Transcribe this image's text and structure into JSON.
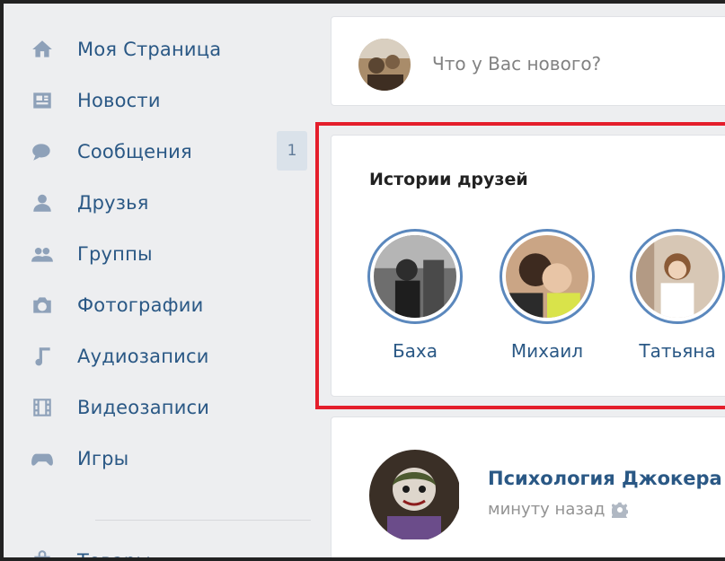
{
  "sidebar": {
    "items": [
      {
        "label": "Моя Страница",
        "icon": "home-icon"
      },
      {
        "label": "Новости",
        "icon": "news-icon"
      },
      {
        "label": "Сообщения",
        "icon": "messages-icon",
        "badge": "1"
      },
      {
        "label": "Друзья",
        "icon": "friends-icon"
      },
      {
        "label": "Группы",
        "icon": "groups-icon"
      },
      {
        "label": "Фотографии",
        "icon": "camera-icon"
      },
      {
        "label": "Аудиозаписи",
        "icon": "music-icon"
      },
      {
        "label": "Видеозаписи",
        "icon": "video-icon"
      },
      {
        "label": "Игры",
        "icon": "gamepad-icon"
      }
    ],
    "market": {
      "label": "Товары",
      "icon": "bag-icon"
    }
  },
  "compose": {
    "placeholder": "Что у Вас нового?"
  },
  "stories": {
    "title": "Истории друзей",
    "items": [
      {
        "name": "Баха"
      },
      {
        "name": "Михаил"
      },
      {
        "name": "Татьяна"
      }
    ]
  },
  "post": {
    "author": "Психология Джокера",
    "time": "минуту назад"
  },
  "colors": {
    "link": "#2a5885",
    "icon": "#8ea1b9",
    "highlight": "#e41e2b",
    "story_ring": "#5b88bd",
    "background": "#edeef0"
  }
}
